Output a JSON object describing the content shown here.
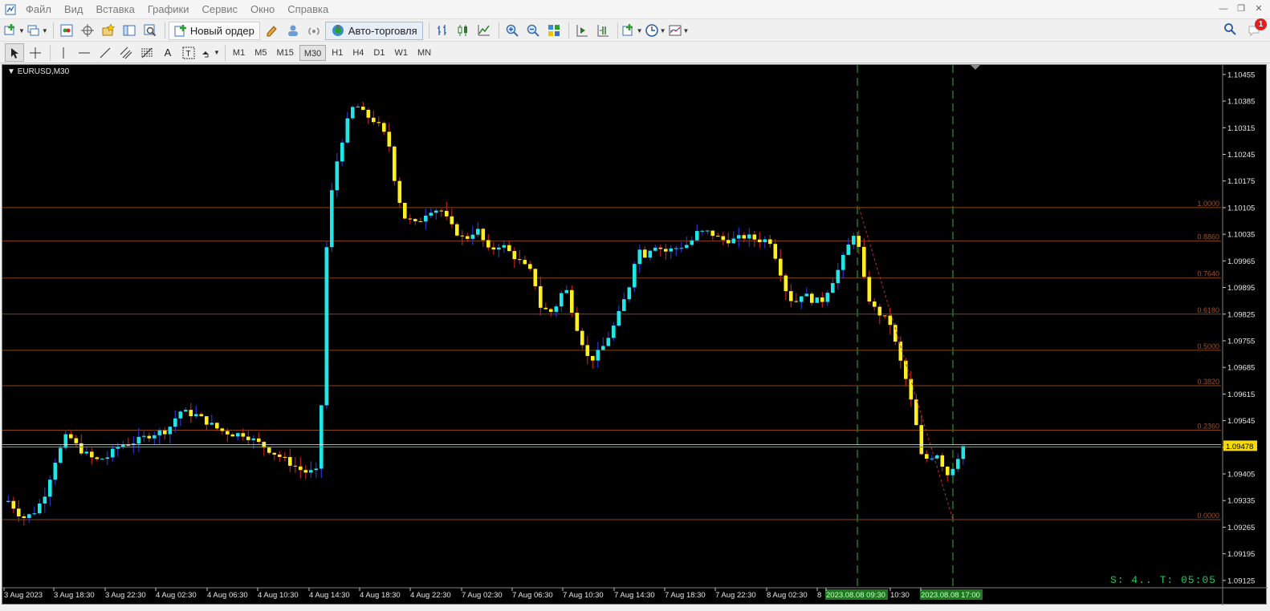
{
  "menu": {
    "items": [
      "Файл",
      "Вид",
      "Вставка",
      "Графики",
      "Сервис",
      "Окно",
      "Справка"
    ]
  },
  "toolbar": {
    "new_order_label": "Новый ордер",
    "autotrade_label": "Авто-торговля",
    "notification_count": "1"
  },
  "timeframes": [
    "M1",
    "M5",
    "M15",
    "M30",
    "H1",
    "H4",
    "D1",
    "W1",
    "MN"
  ],
  "active_timeframe": "M30",
  "chart": {
    "symbol_label": "EURUSD,M30",
    "current_price": "1.09478",
    "timer_text": "S: 4.. T: 05:05",
    "colors": {
      "bull": "#22e5e8",
      "bear": "#ffee22",
      "bull_wick": "#2a35d0",
      "bear_wick": "#c02020",
      "fib": "#8b4513",
      "price_line": "#22c55e",
      "vline": "#1f7a1f"
    }
  },
  "chart_data": {
    "type": "candlestick",
    "y_ticks": [
      "1.10455",
      "1.10385",
      "1.10315",
      "1.10245",
      "1.10175",
      "1.10105",
      "1.10035",
      "1.09965",
      "1.09895",
      "1.09825",
      "1.09755",
      "1.09685",
      "1.09615",
      "1.09545",
      "1.09475",
      "1.09405",
      "1.09335",
      "1.09265",
      "1.09195",
      "1.09125"
    ],
    "ylim": [
      1.0911,
      1.1048
    ],
    "x_ticks": [
      "3 Aug 2023",
      "3 Aug 18:30",
      "3 Aug 22:30",
      "4 Aug 02:30",
      "4 Aug 06:30",
      "4 Aug 10:30",
      "4 Aug 14:30",
      "4 Aug 18:30",
      "4 Aug 22:30",
      "7 Aug 02:30",
      "7 Aug 06:30",
      "7 Aug 10:30",
      "7 Aug 14:30",
      "7 Aug 18:30",
      "7 Aug 22:30",
      "8 Aug 02:30",
      "8",
      "2023.08.08 09:30",
      "10:30",
      "2023.08.08 17:00"
    ],
    "fib_levels": [
      {
        "label": "1.0000",
        "price": 1.10105
      },
      {
        "label": "0.8860",
        "price": 1.10017
      },
      {
        "label": "0.7640",
        "price": 1.0992
      },
      {
        "label": "0.6180",
        "price": 1.09825
      },
      {
        "label": "0.5000",
        "price": 1.0973
      },
      {
        "label": "0.3820",
        "price": 1.09637
      },
      {
        "label": "0.2360",
        "price": 1.0952
      },
      {
        "label": "0.0000",
        "price": 1.09285
      }
    ],
    "current_price": 1.09478
  }
}
